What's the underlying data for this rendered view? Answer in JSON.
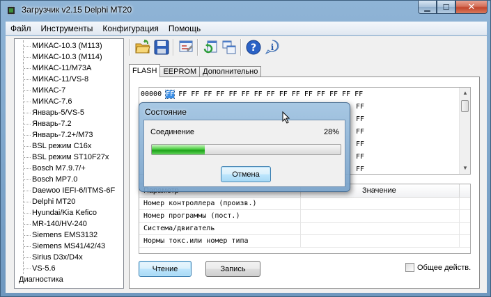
{
  "window": {
    "title": "Загрузчик v2.15 Delphi MT20"
  },
  "menu": [
    "Файл",
    "Инструменты",
    "Конфигурация",
    "Помощь"
  ],
  "tree": {
    "items": [
      "МИКАС-10.3 (M113)",
      "МИКАС-10.3 (M114)",
      "МИКАС-11/M73A",
      "МИКАС-11/VS-8",
      "МИКАС-7",
      "МИКАС-7.6",
      "Январь-5/VS-5",
      "Январь-7.2",
      "Январь-7.2+/M73",
      "BSL режим C16x",
      "BSL режим ST10F27x",
      "Bosch M7.9.7/+",
      "Bosch MP7.0",
      "Daewoo IEFI-6/ITMS-6F",
      "Delphi MT20",
      "Hyundai/Kia Kefico",
      "MR-140/HV-240",
      "Siemens EMS3132",
      "Siemens MS41/42/43",
      "Sirius D3x/D4x",
      "VS-5.6"
    ],
    "root": "Диагностика"
  },
  "tabs": [
    "FLASH",
    "EEPROM",
    "Дополнительно"
  ],
  "hex": {
    "first_address": "00000",
    "first_byte": "FF",
    "first_row_rest": "FF FF FF FF FF FF FF FF FF FF FF FF FF FF FF",
    "partial_rows": [
      "FF",
      "FF",
      "FF",
      "FF",
      "FF",
      "FF"
    ]
  },
  "table": {
    "headers": [
      "Параметр",
      "Значение"
    ],
    "rows": [
      "Номер контроллера (произв.)",
      "Номер программы (пост.)",
      "Система/двигатель",
      "Нормы токс.или номер типа"
    ]
  },
  "buttons": {
    "read": "Чтение",
    "write": "Запись"
  },
  "checkbox": {
    "label": "Общее действ.",
    "checked": false
  },
  "dialog": {
    "title": "Состояние",
    "status": "Соединение",
    "percent": "28%",
    "progress": 0.28,
    "cancel": "Отмена"
  },
  "colors": {
    "accent": "#3a8ee6",
    "progress": "#1ea31a"
  }
}
